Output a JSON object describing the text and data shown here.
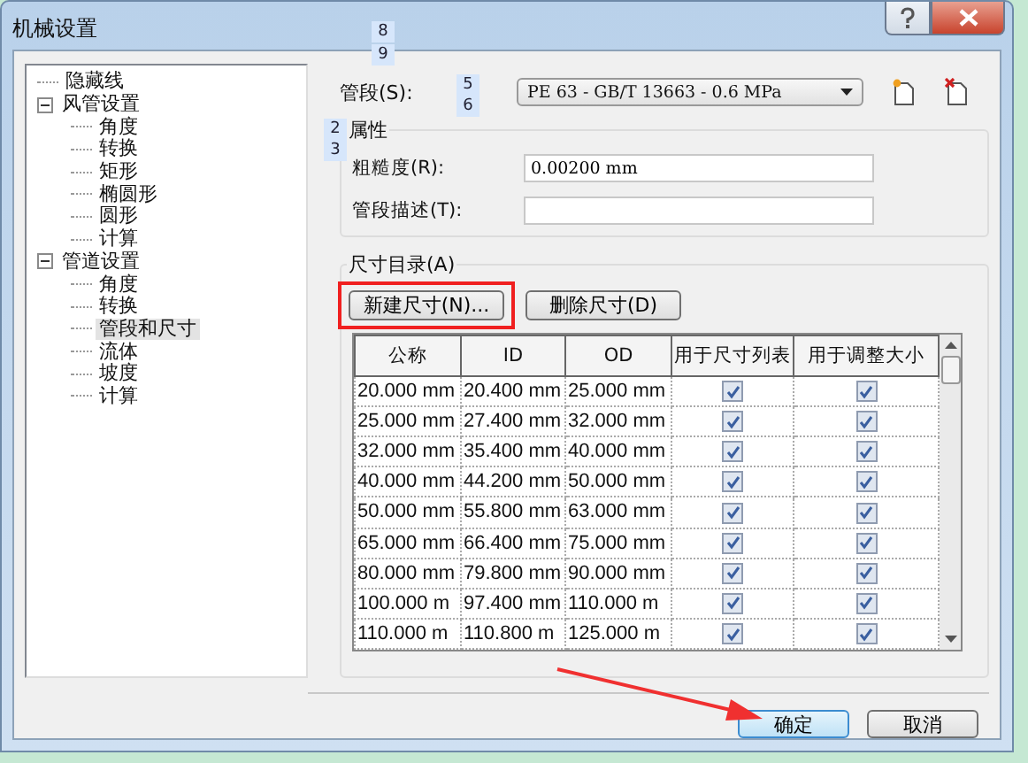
{
  "window": {
    "title": "机械设置"
  },
  "tree": [
    {
      "label": "隐藏线",
      "selected": false
    },
    {
      "label": "风管设置",
      "selected": false,
      "expanded": true,
      "children": [
        {
          "label": "角度",
          "selected": false
        },
        {
          "label": "转换",
          "selected": false
        },
        {
          "label": "矩形",
          "selected": false
        },
        {
          "label": "椭圆形",
          "selected": false
        },
        {
          "label": "圆形",
          "selected": false
        },
        {
          "label": "计算",
          "selected": false
        }
      ]
    },
    {
      "label": "管道设置",
      "selected": false,
      "expanded": true,
      "children": [
        {
          "label": "角度",
          "selected": false
        },
        {
          "label": "转换",
          "selected": false
        },
        {
          "label": "管段和尺寸",
          "selected": true
        },
        {
          "label": "流体",
          "selected": false
        },
        {
          "label": "坡度",
          "selected": false
        },
        {
          "label": "计算",
          "selected": false
        }
      ]
    }
  ],
  "segment": {
    "label": "管段(S):",
    "value": "PE 63 - GB/T 13663 - 0.6 MPa"
  },
  "properties": {
    "legend": "属性",
    "roughness_label": "粗糙度(R):",
    "roughness_value": "0.00200 mm",
    "description_label": "管段描述(T):"
  },
  "catalog": {
    "legend": "尺寸目录(A)",
    "new_button": "新建尺寸(N)...",
    "delete_button": "删除尺寸(D)",
    "columns": [
      "公称",
      "ID",
      "OD",
      "用于尺寸列表",
      "用于调整大小"
    ],
    "rows": [
      {
        "cells": [
          "20.000 mm",
          "20.400 mm",
          "25.000 mm"
        ],
        "in_list": true,
        "in_sizing": true
      },
      {
        "cells": [
          "25.000 mm",
          "27.400 mm",
          "32.000 mm"
        ],
        "in_list": true,
        "in_sizing": true
      },
      {
        "cells": [
          "32.000 mm",
          "35.400 mm",
          "40.000 mm"
        ],
        "in_list": true,
        "in_sizing": true
      },
      {
        "cells": [
          "40.000 mm",
          "44.200 mm",
          "50.000 mm"
        ],
        "in_list": true,
        "in_sizing": true
      },
      {
        "cells": [
          "50.000 mm",
          "55.800 mm",
          "63.000 mm"
        ],
        "in_list": true,
        "in_sizing": true
      },
      {
        "cells": [
          "65.000 mm",
          "66.400 mm",
          "75.000 mm"
        ],
        "in_list": true,
        "in_sizing": true
      },
      {
        "cells": [
          "80.000 mm",
          "79.800 mm",
          "90.000 mm"
        ],
        "in_list": true,
        "in_sizing": true
      },
      {
        "cells": [
          "100.000 m",
          "97.400 mm",
          "110.000 m"
        ],
        "in_list": true,
        "in_sizing": true
      },
      {
        "cells": [
          "110.000 m",
          "110.800 m",
          "125.000 m"
        ],
        "in_list": true,
        "in_sizing": true
      }
    ]
  },
  "buttons": {
    "ok": "确定",
    "cancel": "取消"
  },
  "badges": [
    "8",
    "9",
    "5",
    "6",
    "2",
    "3"
  ]
}
